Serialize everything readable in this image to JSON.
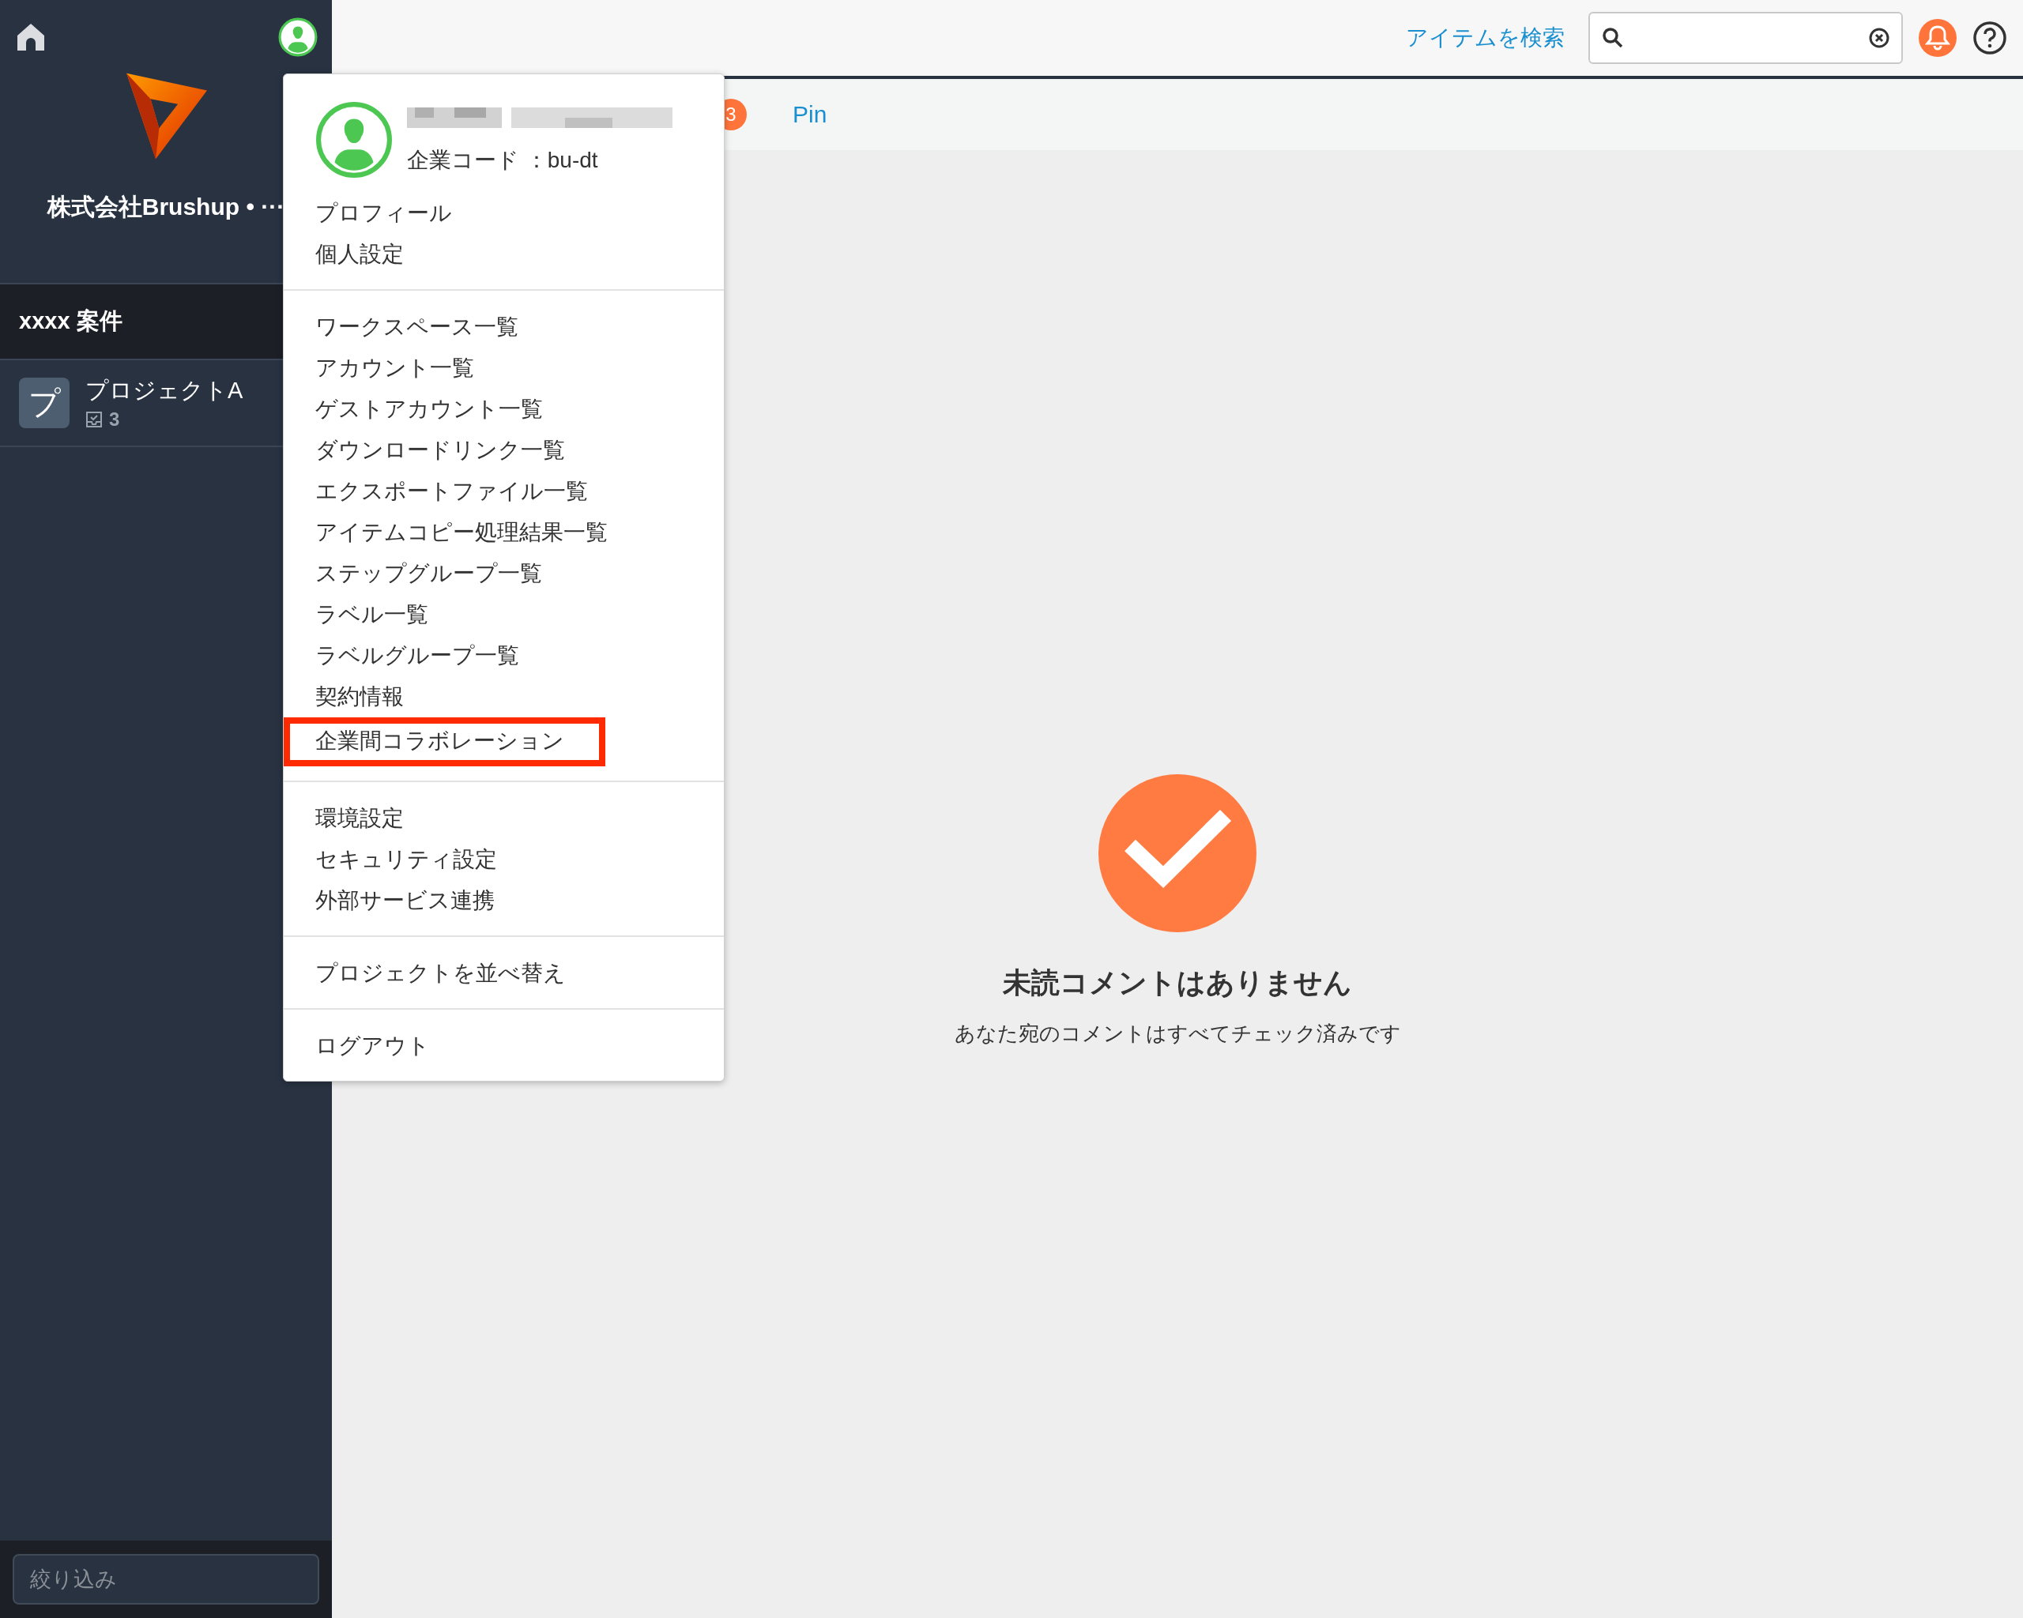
{
  "sidebar": {
    "company": "株式会社Brushup • ···",
    "group": "xxxx 案件",
    "projects": [
      {
        "initial": "プ",
        "name": "プロジェクトA",
        "count": "3"
      }
    ],
    "filter": {
      "placeholder": "絞り込み"
    }
  },
  "topbar": {
    "search_link": "アイテムを検索"
  },
  "tabs": [
    {
      "badge": "3"
    },
    {
      "label": "Pin"
    }
  ],
  "empty_state": {
    "title": "未読コメントはありません",
    "message": "あなた宛のコメントはすべてチェック済みです"
  },
  "user_menu": {
    "company_code": "企業コード ：bu-dt",
    "groups": [
      [
        {
          "label": "プロフィール",
          "highlighted": false
        },
        {
          "label": "個人設定",
          "highlighted": false
        }
      ],
      [
        {
          "label": "ワークスペース一覧",
          "highlighted": false
        },
        {
          "label": "アカウント一覧",
          "highlighted": false
        },
        {
          "label": "ゲストアカウント一覧",
          "highlighted": false
        },
        {
          "label": "ダウンロードリンク一覧",
          "highlighted": false
        },
        {
          "label": "エクスポートファイル一覧",
          "highlighted": false
        },
        {
          "label": "アイテムコピー処理結果一覧",
          "highlighted": false
        },
        {
          "label": "ステップグループ一覧",
          "highlighted": false
        },
        {
          "label": "ラベル一覧",
          "highlighted": false
        },
        {
          "label": "ラベルグループ一覧",
          "highlighted": false
        },
        {
          "label": "契約情報",
          "highlighted": false
        },
        {
          "label": "企業間コラボレーション",
          "highlighted": true
        }
      ],
      [
        {
          "label": "環境設定",
          "highlighted": false
        },
        {
          "label": "セキュリティ設定",
          "highlighted": false
        },
        {
          "label": "外部サービス連携",
          "highlighted": false
        }
      ],
      [
        {
          "label": "プロジェクトを並べ替え",
          "highlighted": false
        }
      ],
      [
        {
          "label": "ログアウト",
          "highlighted": false
        }
      ]
    ]
  }
}
